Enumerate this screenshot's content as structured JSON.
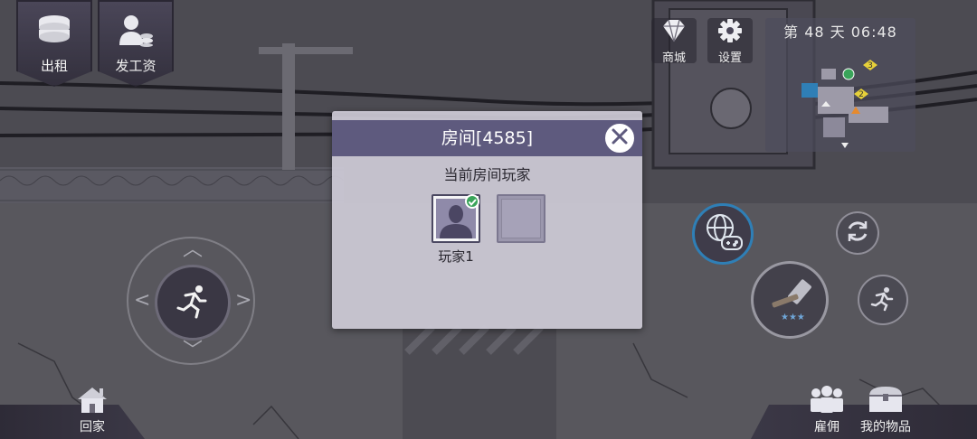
{
  "top_left": {
    "rent_label": "出租",
    "pay_label": "发工资"
  },
  "top_right": {
    "shop_label": "商城",
    "settings_label": "设置",
    "day_text": "第 48 天   06:48",
    "map_markers": [
      "3",
      "2"
    ]
  },
  "bottom": {
    "home_label": "回家",
    "hire_label": "雇佣",
    "items_label": "我的物品"
  },
  "modal": {
    "title": "房间[4585]",
    "section_title": "当前房间玩家",
    "players": [
      {
        "name": "玩家1",
        "ready": true
      },
      {
        "name": "",
        "ready": false
      }
    ]
  },
  "colors": {
    "header": "#5e5a7e",
    "panel": "#cecbd7",
    "accent_blue": "#2f7fb6",
    "ready_green": "#3aa45a"
  },
  "icons": [
    "coins-icon",
    "worker-pay-icon",
    "diamond-icon",
    "gear-icon",
    "run-icon",
    "multiplayer-icon",
    "refresh-icon",
    "hammer-icon",
    "sneak-icon",
    "house-icon",
    "people-icon",
    "chest-icon",
    "close-icon",
    "check-icon"
  ]
}
